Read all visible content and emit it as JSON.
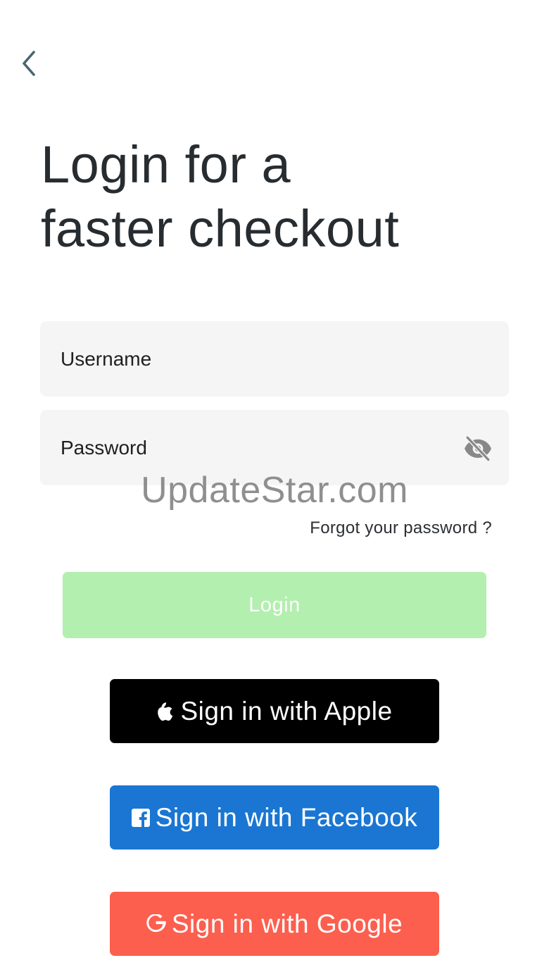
{
  "header": {
    "back_icon": "chevron-left-icon"
  },
  "title": {
    "line1": "Login for a",
    "line2": "faster checkout"
  },
  "form": {
    "username": {
      "placeholder": "Username",
      "value": ""
    },
    "password": {
      "placeholder": "Password",
      "value": "",
      "toggle_icon": "eye-off-icon"
    },
    "forgot_label": "Forgot your password ?",
    "login_label": "Login"
  },
  "watermark": "UpdateStar.com",
  "social": {
    "apple": {
      "label": "Sign in with Apple",
      "icon": "apple-icon",
      "color": "#000000"
    },
    "facebook": {
      "label": "Sign in with Facebook",
      "icon": "facebook-icon",
      "color": "#1A76D2"
    },
    "google": {
      "label": "Sign in with Google",
      "icon": "google-icon",
      "color": "#FC5F4E"
    }
  },
  "colors": {
    "login_disabled": "#B3EFAE",
    "field_background": "#F5F5F5",
    "title_text": "#272C30"
  }
}
